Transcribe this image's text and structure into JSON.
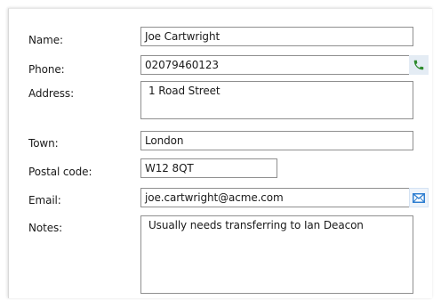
{
  "form": {
    "name": {
      "label": "Name:",
      "value": "Joe Cartwright"
    },
    "phone": {
      "label": "Phone:",
      "value": "02079460123",
      "action_icon": "phone-icon"
    },
    "address": {
      "label": "Address:",
      "value": "1 Road Street"
    },
    "town": {
      "label": "Town:",
      "value": "London"
    },
    "postal_code": {
      "label": "Postal code:",
      "value": "W12 8QT"
    },
    "email": {
      "label": "Email:",
      "value": "joe.cartwright@acme.com",
      "action_icon": "envelope-icon"
    },
    "notes": {
      "label": "Notes:",
      "value": "Usually needs transferring to Ian Deacon"
    }
  },
  "colors": {
    "phone_icon": "#2e8b2e",
    "mail_icon": "#2f7fd1",
    "field_border": "#8f8f8f"
  }
}
